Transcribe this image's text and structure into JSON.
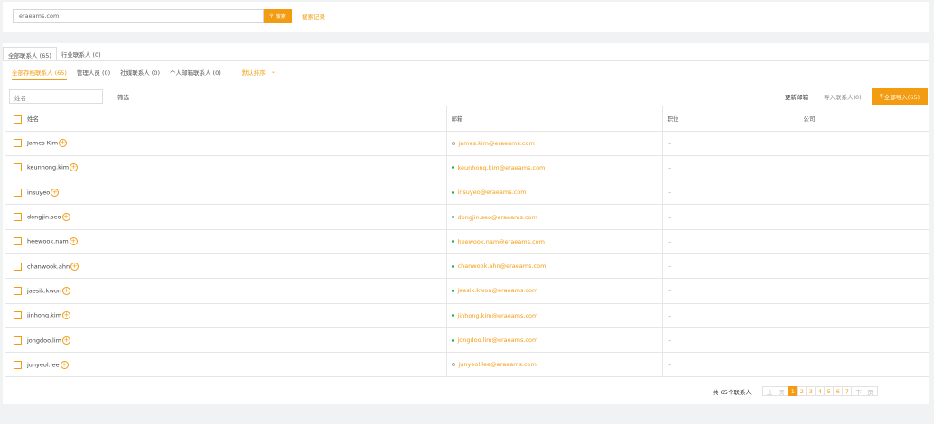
{
  "search": {
    "value": "eraeams.com",
    "button": "搜索",
    "history": "搜索记录"
  },
  "tabs1": [
    {
      "label": "全部联系人 (65)",
      "active": true
    },
    {
      "label": "行业联系人 (0)",
      "active": false
    }
  ],
  "tabs2": [
    {
      "label": "全部存档联系人 (65)",
      "active": true
    },
    {
      "label": "管理人员 (0)",
      "active": false
    },
    {
      "label": "社媒联系人 (0)",
      "active": false
    },
    {
      "label": "个人邮箱联系人 (0)",
      "active": false
    }
  ],
  "sort_label": "默认排序",
  "filter": {
    "placeholder": "姓名",
    "button": "筛选"
  },
  "actions": {
    "update": "更新邮箱",
    "import": "导入联系人(0)",
    "add_all": "全部导入(65)"
  },
  "columns": {
    "name": "姓名",
    "email": "邮箱",
    "position": "职位",
    "company": "公司"
  },
  "rows": [
    {
      "name": "James Kim",
      "email": "james.kim@eraeams.com",
      "status": "unverified",
      "position": "--",
      "company": ""
    },
    {
      "name": "keunhong.kim",
      "email": "keunhong.kim@eraeams.com",
      "status": "verified",
      "position": "--",
      "company": ""
    },
    {
      "name": "insuyeo",
      "email": "insuyeo@eraeams.com",
      "status": "verified",
      "position": "--",
      "company": ""
    },
    {
      "name": "dongjin.seo",
      "email": "dongjin.seo@eraeams.com",
      "status": "verified",
      "position": "--",
      "company": ""
    },
    {
      "name": "heewook.nam",
      "email": "heewook.nam@eraeams.com",
      "status": "verified",
      "position": "--",
      "company": ""
    },
    {
      "name": "chanwook.ahn",
      "email": "chanwook.ahn@eraeams.com",
      "status": "verified",
      "position": "--",
      "company": ""
    },
    {
      "name": "jaesik.kwon",
      "email": "jaesik.kwon@eraeams.com",
      "status": "verified",
      "position": "--",
      "company": ""
    },
    {
      "name": "jinhong.kim",
      "email": "jinhong.kim@eraeams.com",
      "status": "verified",
      "position": "--",
      "company": ""
    },
    {
      "name": "jongdoo.lim",
      "email": "jongdoo.lim@eraeams.com",
      "status": "verified",
      "position": "--",
      "company": ""
    },
    {
      "name": "junyeol.lee",
      "email": "junyeol.lee@eraeams.com",
      "status": "unverified",
      "position": "--",
      "company": ""
    }
  ],
  "pager": {
    "total": "共 65个联系人",
    "prev": "上一页",
    "next": "下一页",
    "pages": [
      "1",
      "2",
      "3",
      "4",
      "5",
      "6",
      "7"
    ],
    "current": "1"
  },
  "colors": {
    "accent": "#f39c12",
    "verified": "#2ea84a"
  }
}
